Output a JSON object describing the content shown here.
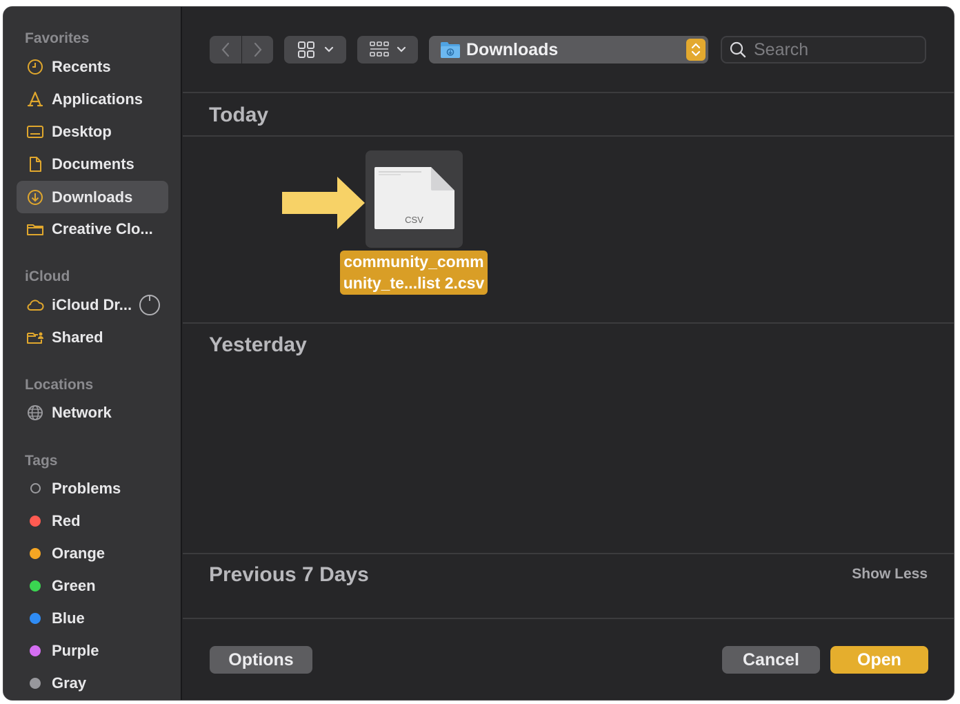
{
  "sidebar": {
    "favorites_label": "Favorites",
    "favorites": [
      {
        "label": "Recents",
        "icon": "clock-icon"
      },
      {
        "label": "Applications",
        "icon": "applications-icon"
      },
      {
        "label": "Desktop",
        "icon": "desktop-icon"
      },
      {
        "label": "Documents",
        "icon": "document-icon"
      },
      {
        "label": "Downloads",
        "icon": "download-icon",
        "selected": true
      },
      {
        "label": "Creative Clo...",
        "icon": "folder-icon"
      }
    ],
    "icloud_label": "iCloud",
    "icloud": [
      {
        "label": "iCloud Dr...",
        "icon": "cloud-icon"
      },
      {
        "label": "Shared",
        "icon": "shared-folder-icon"
      }
    ],
    "locations_label": "Locations",
    "locations": [
      {
        "label": "Network",
        "icon": "globe-icon"
      }
    ],
    "tags_label": "Tags",
    "tags": [
      {
        "label": "Problems",
        "color": ""
      },
      {
        "label": "Red",
        "color": "#ff5b52"
      },
      {
        "label": "Orange",
        "color": "#f6a623"
      },
      {
        "label": "Green",
        "color": "#3ad551"
      },
      {
        "label": "Blue",
        "color": "#2f8cf5"
      },
      {
        "label": "Purple",
        "color": "#d46ef2"
      },
      {
        "label": "Gray",
        "color": "#98989d"
      }
    ]
  },
  "toolbar": {
    "location": "Downloads",
    "search_placeholder": "Search"
  },
  "content": {
    "group_today": "Today",
    "group_yesterday": "Yesterday",
    "group_previous": "Previous 7 Days",
    "show_less": "Show Less",
    "file": {
      "name_line1": "community_comm",
      "name_line2": "unity_te...list 2.csv",
      "type_label": "CSV"
    }
  },
  "buttons": {
    "options": "Options",
    "cancel": "Cancel",
    "open": "Open"
  },
  "colors": {
    "accent": "#e5ae2d",
    "selection": "#d99e26",
    "arrow": "#f7d267"
  }
}
